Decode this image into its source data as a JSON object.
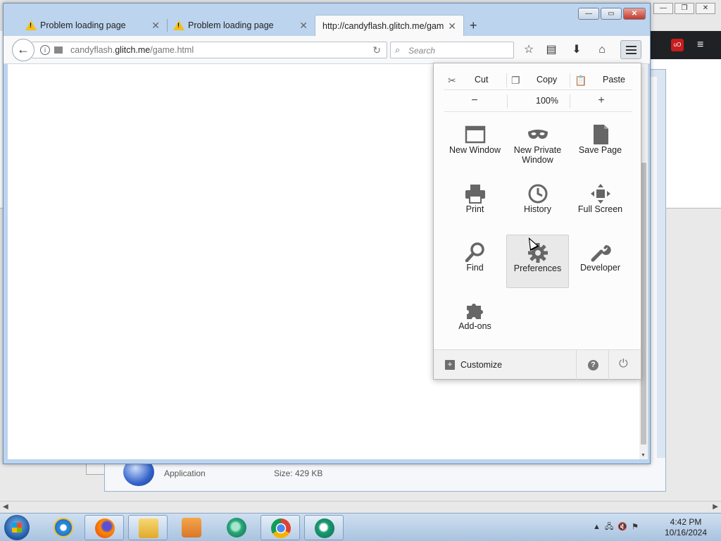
{
  "background": {
    "app_type": "Application",
    "app_size": "Size: 429 KB"
  },
  "window": {
    "min": "—",
    "max": "▭",
    "close": "✕"
  },
  "tabs": [
    {
      "title": "Problem loading page"
    },
    {
      "title": "Problem loading page"
    },
    {
      "title": "http://candyflash.glitch.me/gam"
    }
  ],
  "navbar": {
    "back": "←",
    "url_host": "candyflash.",
    "url_domain": "glitch.me",
    "url_path": "/game.html",
    "reload": "↻",
    "search_placeholder": "Search",
    "icons": [
      "bookmark-star-icon",
      "reading-list-icon",
      "downloads-icon",
      "home-icon",
      "menu-icon"
    ]
  },
  "menu": {
    "edit": {
      "cut": "Cut",
      "copy": "Copy",
      "paste": "Paste"
    },
    "zoom": {
      "minus": "−",
      "value": "100%",
      "plus": "+"
    },
    "items": [
      {
        "label": "New Window",
        "icon": "new-window-icon"
      },
      {
        "label": "New Private Window",
        "icon": "private-mask-icon"
      },
      {
        "label": "Save Page",
        "icon": "save-page-icon"
      },
      {
        "label": "Print",
        "icon": "printer-icon"
      },
      {
        "label": "History",
        "icon": "clock-icon"
      },
      {
        "label": "Full Screen",
        "icon": "fullscreen-icon"
      },
      {
        "label": "Find",
        "icon": "magnifier-icon"
      },
      {
        "label": "Preferences",
        "icon": "gear-icon"
      },
      {
        "label": "Developer",
        "icon": "wrench-icon"
      },
      {
        "label": "Add-ons",
        "icon": "puzzle-icon"
      }
    ],
    "footer": {
      "customize": "Customize",
      "help": "?",
      "quit": "⏻"
    }
  },
  "taskbar": {
    "apps": [
      "internet-explorer-icon",
      "firefox-icon",
      "file-explorer-icon",
      "media-player-icon",
      "green-app-icon",
      "chrome-icon",
      "green-app-2-icon"
    ],
    "time": "4:42 PM",
    "date": "10/16/2024"
  }
}
